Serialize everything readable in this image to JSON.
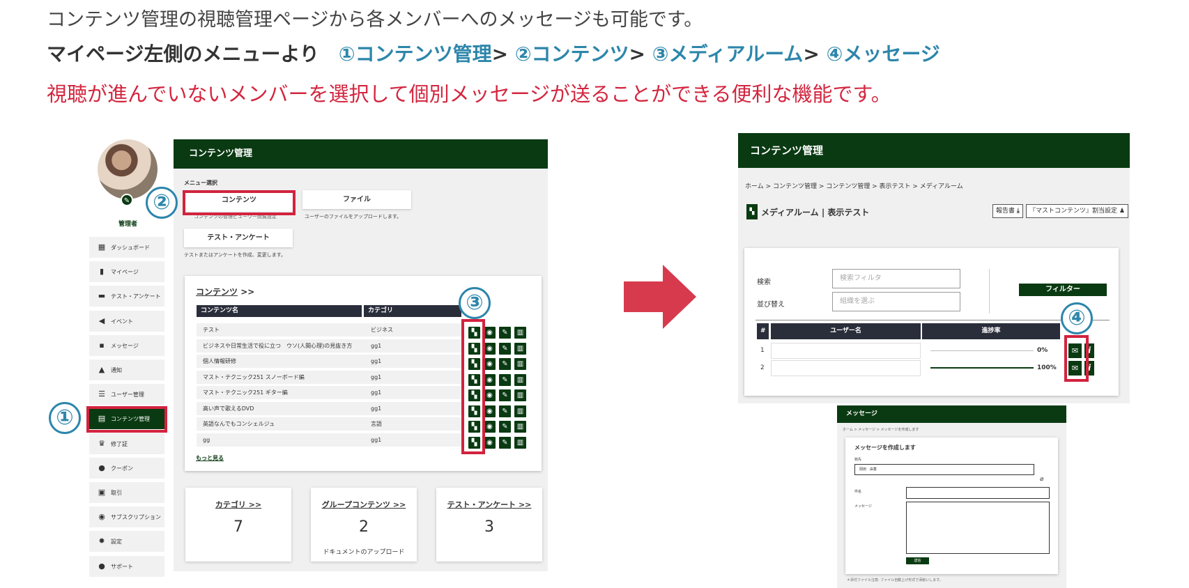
{
  "headline": {
    "line1": "コンテンツ管理の視聴管理ページから各メンバーへのメッセージも可能です。",
    "line2_prefix": "マイページ左側のメニューより　",
    "line2_steps": [
      "①コンテンツ管理",
      "②コンテンツ",
      "③メディアルーム",
      "④メッセージ"
    ],
    "sep": ">",
    "line3": "視聴が進んでいないメンバーを選択して個別メッセージが送ることができる便利な機能です。"
  },
  "step_markers": [
    "①",
    "②",
    "③",
    "④"
  ],
  "left_screen": {
    "role_label": "管理者",
    "header_title": "コンテンツ管理",
    "menu_section": "メニュー選択",
    "menu_buttons": [
      {
        "label": "コンテンツ",
        "desc": "コンテンツの管理ビューワー閲覧設定"
      },
      {
        "label": "ファイル",
        "desc": "ユーザーのファイルをアップロードします。"
      },
      {
        "label": "テスト・アンケート",
        "desc": "テストまたはアンケートを作成、変更します。"
      }
    ],
    "sidebar": [
      {
        "label": "ダッシュボード",
        "icon": "▦"
      },
      {
        "label": "マイページ",
        "icon": "▮"
      },
      {
        "label": "テスト・アンケート",
        "icon": "▬"
      },
      {
        "label": "イベント",
        "icon": "◀"
      },
      {
        "label": "メッセージ",
        "icon": "▪"
      },
      {
        "label": "通知",
        "icon": "▲"
      },
      {
        "label": "ユーザー管理",
        "icon": "☰"
      },
      {
        "label": "コンテンツ管理",
        "icon": "▤"
      },
      {
        "label": "修了証",
        "icon": "♛"
      },
      {
        "label": "クーポン",
        "icon": "●"
      },
      {
        "label": "取引",
        "icon": "▣"
      },
      {
        "label": "サブスクリプション",
        "icon": "◉"
      },
      {
        "label": "設定",
        "icon": "✹"
      },
      {
        "label": "サポート",
        "icon": "●"
      }
    ],
    "content_card": {
      "title": "コンテンツ",
      "arrows": ">>",
      "col_name": "コンテンツ名",
      "col_category": "カテゴリ",
      "rows": [
        {
          "name": "テスト",
          "category": "ビジネス"
        },
        {
          "name": "ビジネスや日常生活で役に立つ　ウソ(人間心理)の見抜き方",
          "category": "gg1"
        },
        {
          "name": "個人情報研修",
          "category": "gg1"
        },
        {
          "name": "マスト・テクニック251 スノーボード編",
          "category": "gg1"
        },
        {
          "name": "マスト・テクニック251 ギター編",
          "category": "gg1"
        },
        {
          "name": "高い声で歌えるDVD",
          "category": "gg1"
        },
        {
          "name": "英語なんでもコンシェルジュ",
          "category": "言語"
        },
        {
          "name": "gg",
          "category": "gg1"
        }
      ],
      "more_link": "もっと見る"
    },
    "stats": [
      {
        "title": "カテゴリ >>",
        "value": "7",
        "sub": ""
      },
      {
        "title": "グループコンテンツ >>",
        "value": "2",
        "sub": "ドキュメントのアップロード"
      },
      {
        "title": "テスト・アンケート >>",
        "value": "3",
        "sub": ""
      }
    ]
  },
  "right_screen": {
    "header_title": "コンテンツ管理",
    "breadcrumb": "ホーム > コンテンツ管理 > コンテンツ管理 > 表示テスト > メディアルーム",
    "page_title": "メディアルーム | 表示テスト",
    "btn_report": "報告書",
    "btn_assign": "『マストコンテンツ』割当設定",
    "search_label": "検索",
    "search_placeholder": "検索フィルタ",
    "sort_label": "並び替え",
    "sort_value": "組織を選ぶ",
    "filter_button": "フィルター",
    "table_headers": [
      "#",
      "ユーザー名",
      "進捗率"
    ],
    "rows": [
      {
        "num": "1",
        "progress": "0%",
        "fill": 0
      },
      {
        "num": "2",
        "progress": "100%",
        "fill": 1
      }
    ]
  },
  "message_screen": {
    "header_title": "メッセージ",
    "breadcrumb": "ホーム > メッセージ > メッセージを作成します",
    "form_title": "メッセージを作成します",
    "to_label": "宛先",
    "to_value": "岡田　由香",
    "subject_label": "件名",
    "message_label": "メッセージ",
    "send_button": "送信",
    "footnote": "＊添付ファイル注意: ファイル自動上げ形式で添削いします。"
  },
  "colors": {
    "accent_green": "#0a3a12",
    "marker_blue": "#2d86ab",
    "highlight_red": "#d2233e",
    "arrow_red": "#d73a4d"
  }
}
